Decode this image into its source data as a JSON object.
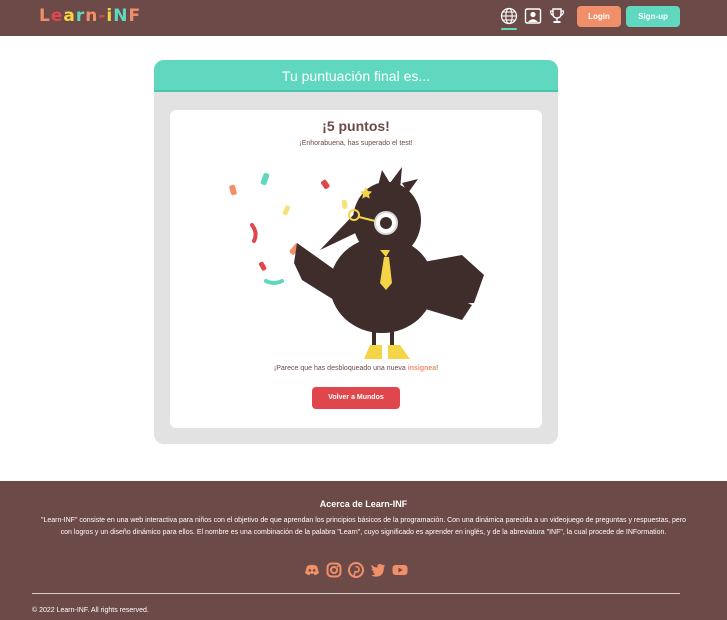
{
  "navbar": {
    "logo_chars": [
      {
        "ch": "L",
        "color": "#f28f6b"
      },
      {
        "ch": "e",
        "color": "#e0474c"
      },
      {
        "ch": "a",
        "color": "#f5d547"
      },
      {
        "ch": "r",
        "color": "#5fd8bf"
      },
      {
        "ch": "n",
        "color": "#f28f6b"
      },
      {
        "ch": "-",
        "color": "#e0474c"
      },
      {
        "ch": "i",
        "color": "#f5d547"
      },
      {
        "ch": "N",
        "color": "#5fd8bf"
      },
      {
        "ch": "F",
        "color": "#f28f6b"
      }
    ],
    "icons": [
      "globe-icon",
      "profile-icon",
      "trophy-icon"
    ],
    "login_label": "Login",
    "signup_label": "Sign-up",
    "accent": "#5fd8bf"
  },
  "result": {
    "header": "Tu puntuación final es...",
    "score": "¡5 puntos!",
    "congrats": "¡Enhorabuena, has superado el test!",
    "badge_msg_prefix": "¡Parece que has desbloqueado una nueva ",
    "badge_word": "insignea",
    "badge_msg_suffix": "!",
    "back_button": "Volver a Mundos"
  },
  "footer": {
    "title": "Acerca de Learn-INF",
    "description": "\"Learn-INF\" consiste en una web interactiva para niños con el objetivo de que aprendan los principios básicos de la programación. Con una dinámica parecida a un videojuego de preguntas y respuestas, pero con logros y un diseño dinámico para ellos. El nombre es una combinación de la palabra \"Learn\", cuyo significado es aprender en inglés, y de la abreviatura \"INF\", la cual procede de INFormation.",
    "social_icons": [
      "discord-icon",
      "instagram-icon",
      "pinterest-icon",
      "twitter-icon",
      "youtube-icon"
    ],
    "social_color": "#f28f6b",
    "copyright": "© 2022 Learn-INF. All rights reserved."
  }
}
